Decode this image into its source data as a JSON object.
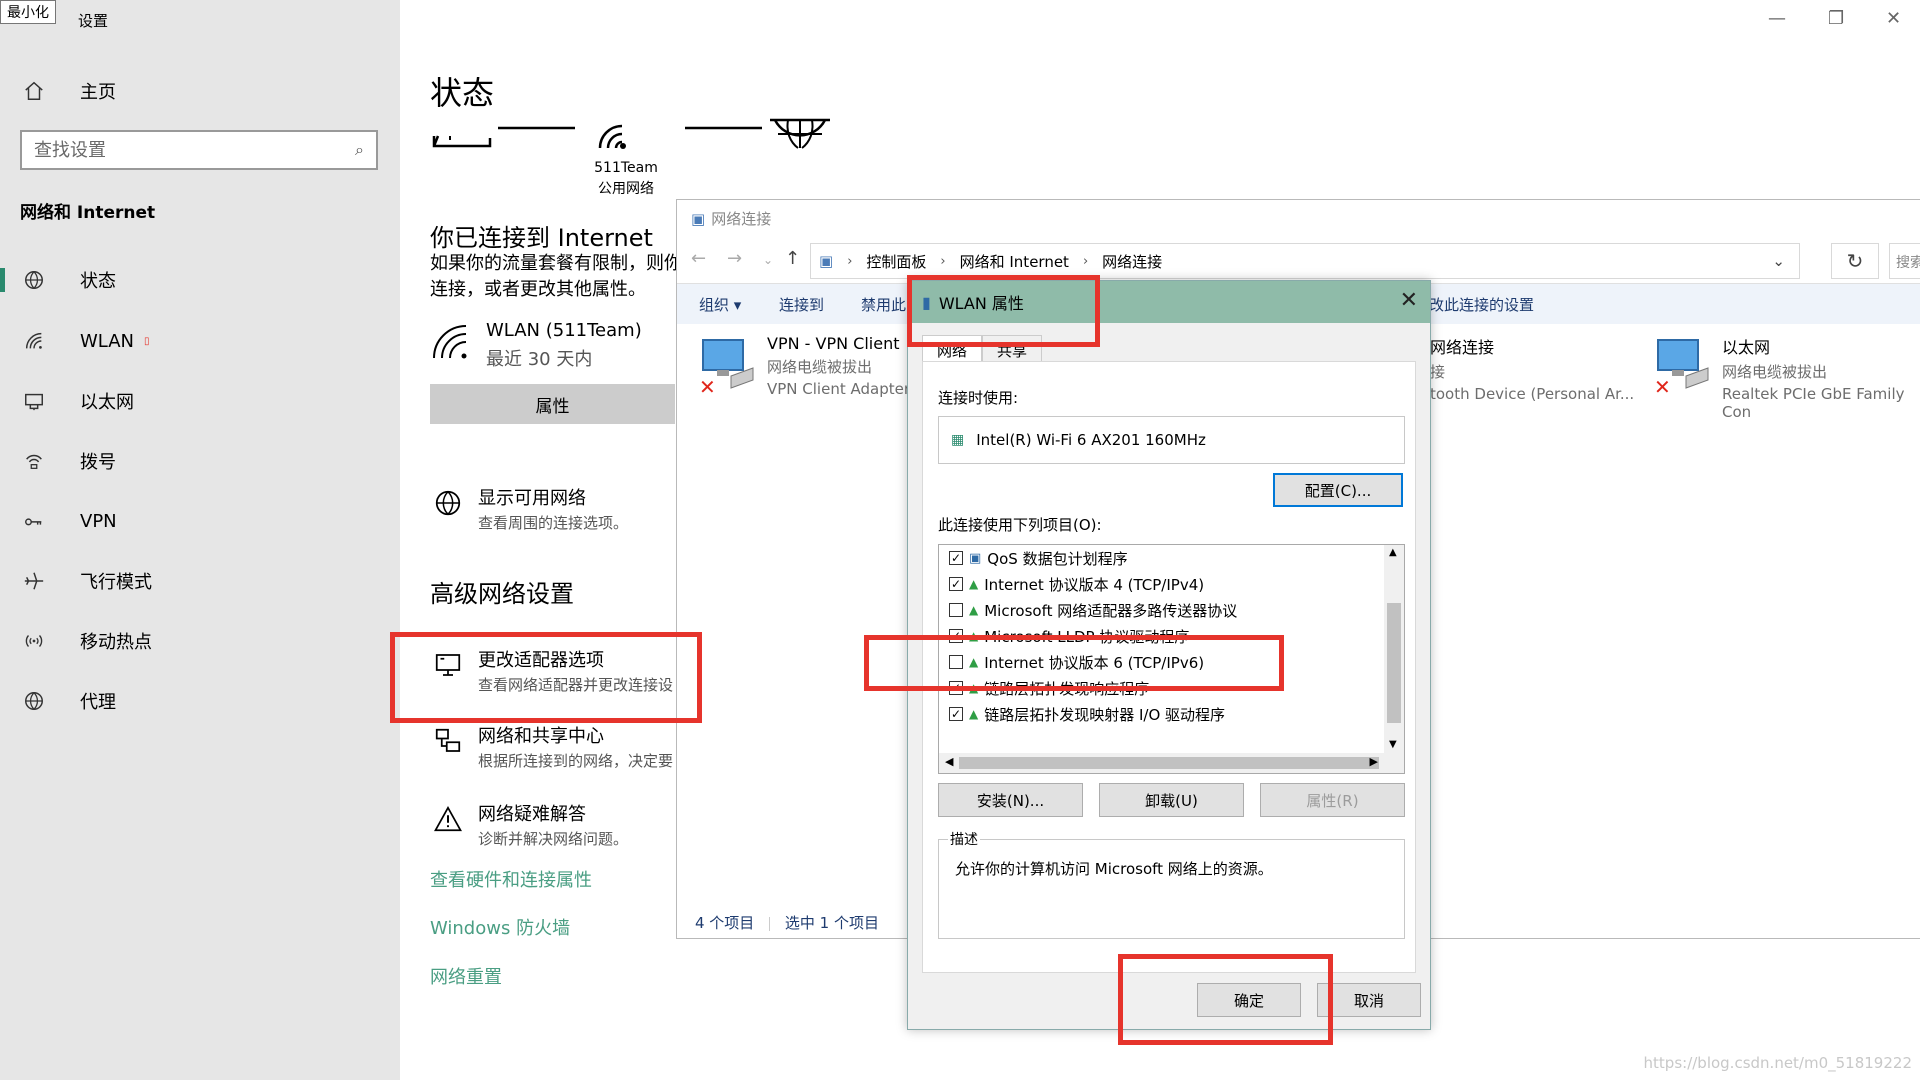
{
  "settings": {
    "tooltip": "最小化",
    "app_title": "设置",
    "home": "主页",
    "search_placeholder": "查找设置",
    "group": "网络和 Internet",
    "nav": [
      {
        "label": "状态",
        "icon": "globe-icon"
      },
      {
        "label": "WLAN",
        "icon": "wifi-icon"
      },
      {
        "label": "以太网",
        "icon": "ethernet-icon"
      },
      {
        "label": "拨号",
        "icon": "dialup-icon"
      },
      {
        "label": "VPN",
        "icon": "vpn-icon"
      },
      {
        "label": "飞行模式",
        "icon": "airplane-icon"
      },
      {
        "label": "移动热点",
        "icon": "hotspot-icon"
      },
      {
        "label": "代理",
        "icon": "globe-icon"
      }
    ],
    "page_title": "状态",
    "network_name": "511Team",
    "network_type": "公用网络",
    "connected_title": "你已连接到 Internet",
    "connected_desc_1": "如果你的流量套餐有限制，则你",
    "connected_desc_2": "连接，或者更改其他属性。",
    "wlan_name": "WLAN (511Team)",
    "wlan_usage": "最近 30 天内",
    "properties_button": "属性",
    "show_networks_title": "显示可用网络",
    "show_networks_desc": "查看周围的连接选项。",
    "advanced_title": "高级网络设置",
    "adapter_options_title": "更改适配器选项",
    "adapter_options_desc": "查看网络适配器并更改连接设",
    "sharing_title": "网络和共享中心",
    "sharing_desc": "根据所连接到的网络，决定要",
    "troubleshoot_title": "网络疑难解答",
    "troubleshoot_desc": "诊断并解决网络问题。",
    "link_hardware": "查看硬件和连接属性",
    "link_firewall": "Windows 防火墙",
    "link_reset": "网络重置"
  },
  "netconn": {
    "title": "网络连接",
    "breadcrumb": [
      "控制面板",
      "网络和 Internet",
      "网络连接"
    ],
    "search_placeholder": "搜索",
    "toolbar": {
      "organize": "组织 ▾",
      "connect_to": "连接到",
      "disable": "禁用此",
      "change_settings": "改此连接的设置"
    },
    "adapters": [
      {
        "name": "VPN - VPN Client",
        "status": "网络电缆被拔出",
        "device": "VPN Client Adapter",
        "disconnected": true
      },
      {
        "name": "网络连接",
        "status": "接",
        "device": "tooth Device (Personal Ar...",
        "disconnected": false
      },
      {
        "name": "以太网",
        "status": "网络电缆被拔出",
        "device": "Realtek PCIe GbE Family Con",
        "disconnected": true
      }
    ],
    "status_count": "4 个项目",
    "status_selected": "选中 1 个项目"
  },
  "dialog": {
    "title": "WLAN 属性",
    "tabs": [
      "网络",
      "共享"
    ],
    "connect_using_label": "连接时使用:",
    "device": "Intel(R) Wi-Fi 6 AX201 160MHz",
    "configure_button": "配置(C)...",
    "items_label": "此连接使用下列项目(O):",
    "items": [
      {
        "label": "QoS 数据包计划程序",
        "checked": true
      },
      {
        "label": "Internet 协议版本 4 (TCP/IPv4)",
        "checked": true
      },
      {
        "label": "Microsoft 网络适配器多路传送器协议",
        "checked": false
      },
      {
        "label": "Microsoft LLDP 协议驱动程序",
        "checked": true
      },
      {
        "label": "Internet 协议版本 6 (TCP/IPv6)",
        "checked": false
      },
      {
        "label": "链路层拓扑发现响应程序",
        "checked": true
      },
      {
        "label": "链路层拓扑发现映射器 I/O 驱动程序",
        "checked": true
      }
    ],
    "install_button": "安装(N)...",
    "uninstall_button": "卸载(U)",
    "properties_button": "属性(R)",
    "description_label": "描述",
    "description_text": "允许你的计算机访问 Microsoft 网络上的资源。",
    "ok_button": "确定",
    "cancel_button": "取消"
  },
  "colors": {
    "highlight_box": "#e6342c",
    "accent_green": "#2a8a6e",
    "dialog_titlebar": "#8fbba9"
  },
  "watermark": "https://blog.csdn.net/m0_51819222"
}
